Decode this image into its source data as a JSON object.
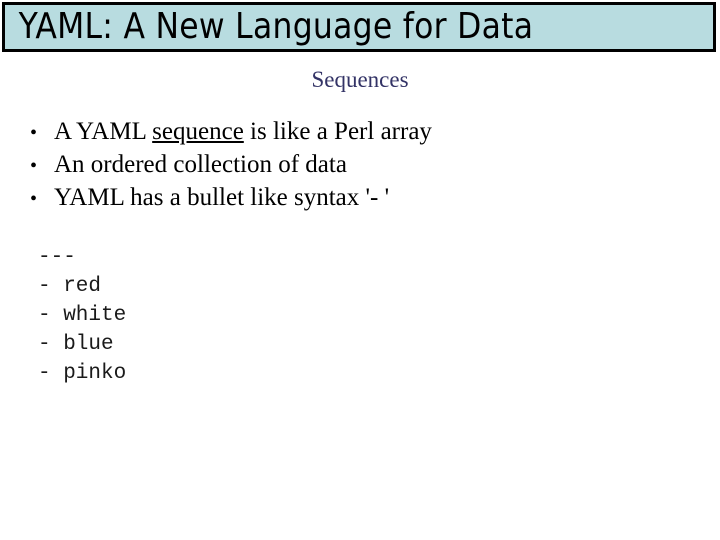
{
  "slide": {
    "title": "YAML: A New Language for Data",
    "subtitle": "Sequences",
    "title_bar_color": "#b8dce0",
    "title_border_color": "#000000",
    "subtitle_color": "#333366",
    "body_background": "#ffffff"
  },
  "bullets": [
    {
      "marker": "•",
      "pre": "A YAML ",
      "emphasis": "sequence",
      "post": " is like a Perl array"
    },
    {
      "marker": "•",
      "pre": "An ordered collection of data",
      "emphasis": "",
      "post": ""
    },
    {
      "marker": "•",
      "pre": "YAML has a bullet like syntax '- '",
      "emphasis": "",
      "post": ""
    }
  ],
  "code": {
    "lines": [
      "---",
      "- red",
      "- white",
      "- blue",
      "- pinko"
    ]
  }
}
